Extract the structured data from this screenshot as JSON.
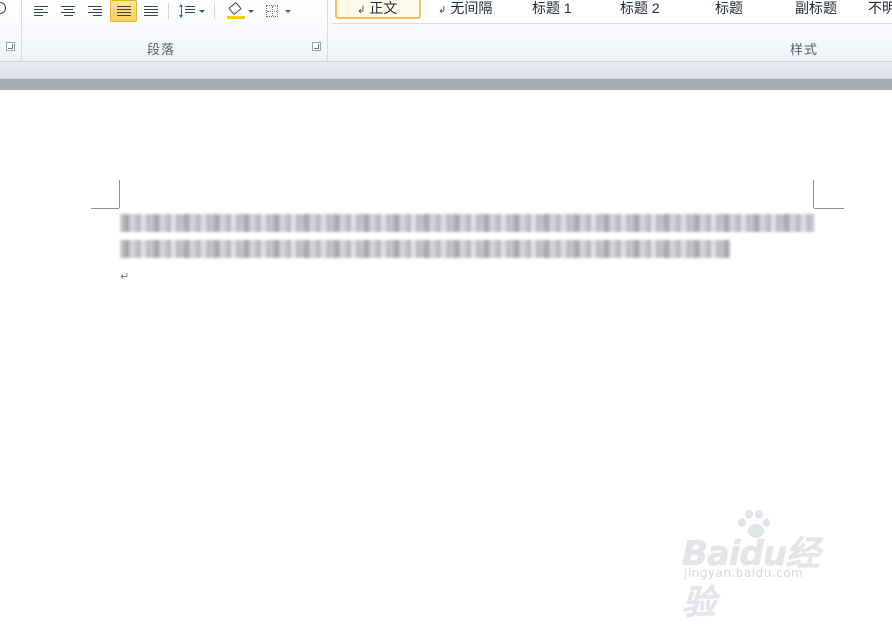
{
  "ribbon": {
    "paragraph_group": {
      "label": "段落",
      "buttons": [
        {
          "name": "align-left",
          "active": false
        },
        {
          "name": "align-center",
          "active": false
        },
        {
          "name": "align-right",
          "active": false
        },
        {
          "name": "justify",
          "active": true
        },
        {
          "name": "distributed",
          "active": false
        },
        {
          "name": "line-spacing",
          "active": false
        },
        {
          "name": "shading",
          "active": false
        },
        {
          "name": "borders",
          "active": false
        }
      ]
    },
    "styles_group": {
      "label": "样式",
      "items": [
        {
          "label": "正文",
          "selected": true,
          "para_mark": "↲"
        },
        {
          "label": "无间隔",
          "selected": false,
          "para_mark": "↲"
        },
        {
          "label": "标题 1",
          "selected": false
        },
        {
          "label": "标题 2",
          "selected": false
        },
        {
          "label": "标题",
          "selected": false
        },
        {
          "label": "副标题",
          "selected": false
        },
        {
          "label": "不明",
          "selected": false
        }
      ]
    },
    "accent_active": "#f8cf55"
  },
  "document": {
    "paragraph_end_mark": "↵"
  },
  "watermark": {
    "logo": "Baidu经验",
    "url": "jingyan.baidu.com"
  }
}
